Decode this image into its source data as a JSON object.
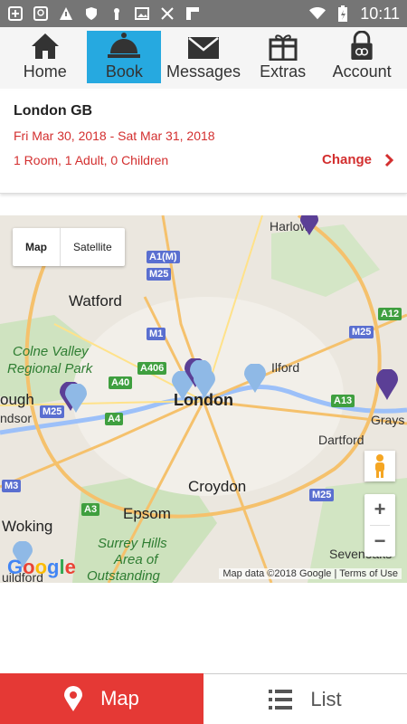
{
  "status_bar": {
    "time": "10:11"
  },
  "nav": {
    "items": [
      {
        "label": "Home",
        "icon": "home-icon"
      },
      {
        "label": "Book",
        "icon": "bell-icon",
        "active": true
      },
      {
        "label": "Messages",
        "icon": "envelope-icon"
      },
      {
        "label": "Extras",
        "icon": "gift-icon"
      },
      {
        "label": "Account",
        "icon": "lock-icon"
      }
    ]
  },
  "booking": {
    "city": "London GB",
    "dates": "Fri Mar 30, 2018 - Sat Mar 31, 2018",
    "occupancy": "1 Room, 1 Adult, 0 Children",
    "change_label": "Change"
  },
  "map": {
    "toggle_map": "Map",
    "toggle_satellite": "Satellite",
    "attribution": "Map data ©2018 Google",
    "terms": "Terms of Use",
    "google": "Google",
    "labels": {
      "harlow": "Harlow",
      "watford": "Watford",
      "colne_valley": "Colne Valley",
      "regional_park": "Regional Park",
      "ough": "ough",
      "ndsor": "ndsor",
      "london": "London",
      "ilford": "Ilford",
      "grays": "Grays",
      "dartford": "Dartford",
      "croydon": "Croydon",
      "woking": "Woking",
      "epsom": "Epsom",
      "surrey1": "Surrey Hills",
      "surrey2": "Area of",
      "surrey3": "Outstanding",
      "sevenoaks": "Sevenoaks",
      "uildford": "uildford"
    },
    "shields": {
      "a1m": "A1(M)",
      "m25a": "M25",
      "m1": "M1",
      "a406": "A406",
      "a40": "A40",
      "m25b": "M25",
      "a4": "A4",
      "m3": "M3",
      "a12": "A12",
      "m25c": "M25",
      "a13": "A13",
      "m25d": "M25",
      "a3": "A3"
    }
  },
  "bottom": {
    "map_label": "Map",
    "list_label": "List"
  },
  "colors": {
    "accent_red": "#e53935",
    "active_tab": "#26a9e0",
    "text_red": "#d32f2f"
  }
}
